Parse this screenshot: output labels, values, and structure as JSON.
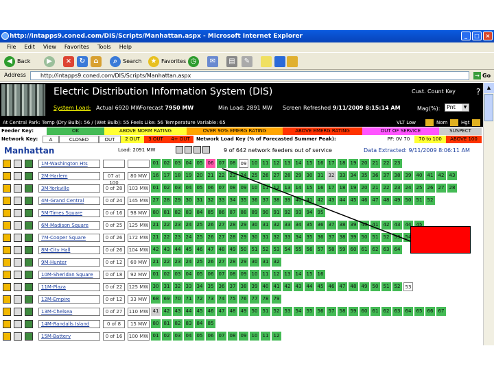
{
  "window": {
    "title": "http://intapps9.coned.com/DIS/Scripts/Manhattan.aspx - Microsoft Internet Explorer"
  },
  "menu": [
    "File",
    "Edit",
    "View",
    "Favorites",
    "Tools",
    "Help"
  ],
  "toolbar": {
    "back": "Back",
    "search": "Search",
    "favorites": "Favorites"
  },
  "address": {
    "label": "Address",
    "url": "http://intapps9.coned.com/DIS/Scripts/Manhattan.aspx",
    "go": "Go"
  },
  "banner": {
    "title": "Electric Distribution Information System (DIS)",
    "cust_count_key": "Cust. Count Key",
    "help": "?",
    "system_load_label": "System Load:",
    "actual": "Actual 6920 MW",
    "forecast_label": "Forecast",
    "forecast": "7950 MW",
    "min_load": "Min Load: 2891 MW",
    "refreshed_label": "Screen Refreshed",
    "refreshed": "9/11/2009 8:15:14 AM",
    "mag_label": "Mag(%):",
    "mag_value": "Pnt",
    "volt_low": "VLT Low",
    "nom": "Nom",
    "high": "Hgt"
  },
  "status_line": "At Central Park: Temp (Dry Bulb): 56 / (Wet Bulb): 55   Feels Like: 56      Temperature Variable: 65",
  "feeder_key": {
    "label": "Feeder Key:",
    "items": [
      {
        "text": "OK",
        "color": "#44bb55"
      },
      {
        "text": "ABOVE NORM RATING",
        "color": "#ffff33"
      },
      {
        "text": "OVER 90% EMERG RATING",
        "color": "#ffa500"
      },
      {
        "text": "ABOVE EMERG RATING",
        "color": "#ff3300"
      },
      {
        "text": "OUT OF SERVICE",
        "color": "#ff55ff"
      },
      {
        "text": "SUSPECT",
        "color": "#cccccc"
      }
    ]
  },
  "network_key": {
    "label": "Network Key:",
    "items": [
      {
        "text": "A",
        "color": "#ffffff"
      },
      {
        "text": "CLOSED",
        "color": "#ffffff"
      },
      {
        "text": "OUT",
        "color": "#ffffff"
      },
      {
        "text": "2 OUT",
        "color": "#ffff33"
      },
      {
        "text": "3 OUT",
        "color": "#ff3300"
      },
      {
        "text": "4+ OUT",
        "color": "#ff3300"
      }
    ],
    "load_label": "Network Load Key (% of Forecasted Summer Peak):",
    "load_items": [
      {
        "text": "PF: 0V 70",
        "color": "#ffffff"
      },
      {
        "text": "70 to 100",
        "color": "#ffff33"
      },
      {
        "text": "ABOVE 100",
        "color": "#ff3300"
      }
    ]
  },
  "manhattan": {
    "title": "Manhattan",
    "load": "Load: 2091 MW",
    "feeders_out": "9 of 642 network feeders out of service",
    "extracted": "Data Extracted: 9/11/2009 8:06:11 AM"
  },
  "rows": [
    {
      "name": "1M-Washington Hts",
      "a": "",
      "b": "",
      "feeds": [
        "01",
        "02",
        "03",
        "04",
        "05",
        "06",
        "07",
        "08",
        "09",
        "10",
        "11",
        "12",
        "13",
        "14",
        "15",
        "16",
        "17",
        "18",
        "19",
        "20",
        "21",
        "22",
        "23"
      ],
      "out": [
        5
      ],
      "white": [
        8
      ]
    },
    {
      "name": "2M-Harlem",
      "a": "07 at 100",
      "b": "80 MW",
      "feeds": [
        "16",
        "17",
        "18",
        "19",
        "20",
        "21",
        "22",
        "23",
        "24",
        "25",
        "26",
        "27",
        "28",
        "29",
        "30",
        "31",
        "32",
        "33",
        "34",
        "35",
        "36",
        "37",
        "38",
        "39",
        "40",
        "41",
        "42",
        "43"
      ],
      "grey": [
        16
      ]
    },
    {
      "name": "3M-Yorkville",
      "a": "0 of 28",
      "b": "103 MW",
      "feeds": [
        "01",
        "02",
        "03",
        "04",
        "05",
        "06",
        "07",
        "08",
        "09",
        "10",
        "11",
        "12",
        "13",
        "14",
        "15",
        "16",
        "17",
        "18",
        "19",
        "20",
        "21",
        "22",
        "23",
        "24",
        "25",
        "26",
        "27",
        "28"
      ]
    },
    {
      "name": "4M-Grand Central",
      "a": "0 of 24",
      "b": "145 MW",
      "feeds": [
        "27",
        "28",
        "29",
        "30",
        "31",
        "32",
        "33",
        "34",
        "35",
        "36",
        "37",
        "38",
        "39",
        "40",
        "41",
        "42",
        "43",
        "44",
        "45",
        "46",
        "47",
        "48",
        "49",
        "50",
        "51",
        "52"
      ]
    },
    {
      "name": "5M-Times Square",
      "a": "0 of 16",
      "b": "98 MW",
      "feeds": [
        "80",
        "81",
        "82",
        "83",
        "84",
        "85",
        "86",
        "87",
        "88",
        "89",
        "90",
        "91",
        "92",
        "93",
        "94",
        "95"
      ]
    },
    {
      "name": "6M-Madison Square",
      "a": "0 of 25",
      "b": "125 MW",
      "feeds": [
        "21",
        "22",
        "23",
        "24",
        "25",
        "26",
        "27",
        "28",
        "29",
        "30",
        "31",
        "32",
        "33",
        "34",
        "35",
        "36",
        "37",
        "38",
        "39",
        "40",
        "41",
        "42",
        "43",
        "44",
        "45"
      ]
    },
    {
      "name": "7M-Cooper Square",
      "a": "0 of 26",
      "b": "172 MW",
      "feeds": [
        "21",
        "22",
        "23",
        "24",
        "25",
        "26",
        "27",
        "28",
        "29",
        "30",
        "31",
        "32",
        "33",
        "34",
        "35",
        "36",
        "37",
        "38",
        "39",
        "50",
        "51",
        "52",
        "53",
        "54",
        "55"
      ]
    },
    {
      "name": "8M-City Hall",
      "a": "0 of 26",
      "b": "104 MW",
      "feeds": [
        "42",
        "43",
        "44",
        "45",
        "46",
        "47",
        "48",
        "49",
        "50",
        "51",
        "52",
        "53",
        "54",
        "55",
        "56",
        "57",
        "58",
        "59",
        "60",
        "61",
        "62",
        "63",
        "64"
      ]
    },
    {
      "name": "9M-Hunter",
      "a": "0 of 12",
      "b": "60 MW",
      "feeds": [
        "21",
        "22",
        "23",
        "24",
        "25",
        "26",
        "27",
        "28",
        "29",
        "30",
        "31",
        "32"
      ]
    },
    {
      "name": "10M-Sheridan Square",
      "a": "0 of 18",
      "b": "92 MW",
      "feeds": [
        "01",
        "02",
        "03",
        "04",
        "05",
        "06",
        "07",
        "08",
        "09",
        "10",
        "11",
        "12",
        "13",
        "14",
        "15",
        "16"
      ]
    },
    {
      "name": "11M-Plaza",
      "a": "0 of 22",
      "b": "125 MW",
      "feeds": [
        "30",
        "31",
        "32",
        "33",
        "34",
        "35",
        "36",
        "37",
        "38",
        "39",
        "40",
        "41",
        "42",
        "43",
        "44",
        "45",
        "46",
        "47",
        "48",
        "49",
        "50",
        "51",
        "52",
        "53"
      ],
      "white": [
        23
      ]
    },
    {
      "name": "12M-Empire",
      "a": "0 of 12",
      "b": "33 MW",
      "feeds": [
        "68",
        "69",
        "70",
        "71",
        "72",
        "73",
        "74",
        "75",
        "76",
        "77",
        "78",
        "79"
      ]
    },
    {
      "name": "13M-Chelsea",
      "a": "0 of 27",
      "b": "110 MW",
      "feeds": [
        "41",
        "42",
        "43",
        "44",
        "45",
        "46",
        "47",
        "48",
        "49",
        "50",
        "51",
        "52",
        "53",
        "54",
        "55",
        "56",
        "57",
        "58",
        "59",
        "60",
        "61",
        "62",
        "63",
        "64",
        "65",
        "66",
        "67"
      ],
      "grey": [
        0
      ]
    },
    {
      "name": "14M-Randalls Island",
      "a": "0 of 8",
      "b": "15 MW",
      "feeds": [
        "80",
        "81",
        "82",
        "83",
        "84",
        "85"
      ]
    },
    {
      "name": "15M-Battery",
      "a": "0 of 16",
      "b": "100 MW",
      "feeds": [
        "01",
        "02",
        "03",
        "04",
        "05",
        "06",
        "07",
        "08",
        "09",
        "10",
        "11",
        "12"
      ]
    }
  ]
}
